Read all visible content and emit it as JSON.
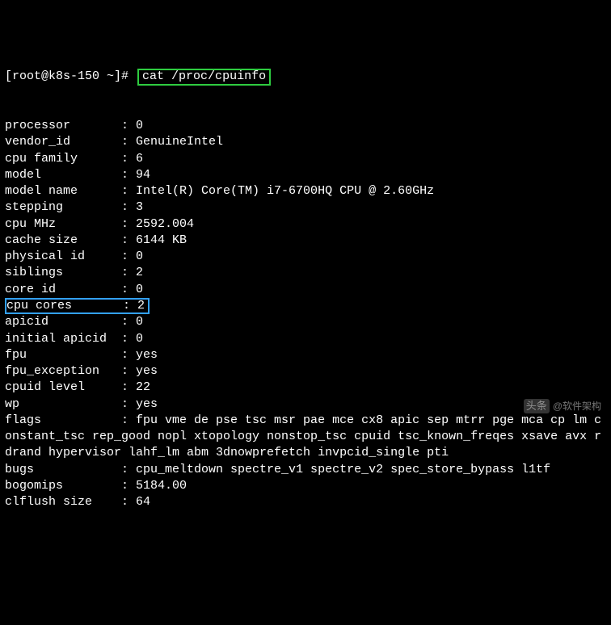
{
  "prompt": {
    "user_host": "[root@k8s-150 ~]#",
    "command": "cat /proc/cpuinfo"
  },
  "cpuinfo": {
    "processor": {
      "label": "processor",
      "value": "0"
    },
    "vendor_id": {
      "label": "vendor_id",
      "value": "GenuineIntel"
    },
    "cpu_family": {
      "label": "cpu family",
      "value": "6"
    },
    "model": {
      "label": "model",
      "value": "94"
    },
    "model_name": {
      "label": "model name",
      "value": "Intel(R) Core(TM) i7-6700HQ CPU @ 2.60GHz"
    },
    "stepping": {
      "label": "stepping",
      "value": "3"
    },
    "cpu_mhz": {
      "label": "cpu MHz",
      "value": "2592.004"
    },
    "cache_size": {
      "label": "cache size",
      "value": "6144 KB"
    },
    "physical_id": {
      "label": "physical id",
      "value": "0"
    },
    "siblings": {
      "label": "siblings",
      "value": "2"
    },
    "core_id": {
      "label": "core id",
      "value": "0"
    },
    "cpu_cores": {
      "label": "cpu cores",
      "value": "2"
    },
    "apicid": {
      "label": "apicid",
      "value": "0"
    },
    "initial_apicid": {
      "label": "initial apicid",
      "value": "0"
    },
    "fpu": {
      "label": "fpu",
      "value": "yes"
    },
    "fpu_exception": {
      "label": "fpu_exception",
      "value": "yes"
    },
    "cpuid_level": {
      "label": "cpuid level",
      "value": "22"
    },
    "wp": {
      "label": "wp",
      "value": "yes"
    },
    "flags": {
      "label": "flags",
      "value": "fpu vme de pse tsc msr pae mce cx8 apic sep mtrr pge mca cp lm constant_tsc rep_good nopl xtopology nonstop_tsc cpuid tsc_known_freqes xsave avx rdrand hypervisor lahf_lm abm 3dnowprefetch invpcid_single pti"
    },
    "bugs": {
      "label": "bugs",
      "value": "cpu_meltdown spectre_v1 spectre_v2 spec_store_bypass l1tf"
    },
    "bogomips": {
      "label": "bogomips",
      "value": "5184.00"
    },
    "clflush_size": {
      "label": "clflush size",
      "value": "64"
    }
  },
  "highlight": {
    "cmd_color": "#2ecc40",
    "row_color": "#33a1fd",
    "highlighted_row_key": "cpu_cores"
  },
  "watermark": {
    "logo": "头条",
    "text": "@软件架构"
  }
}
